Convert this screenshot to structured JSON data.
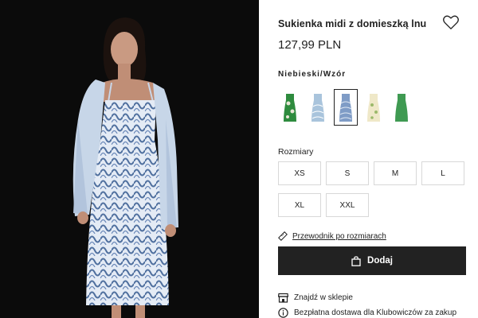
{
  "product": {
    "title": "Sukienka midi z domieszką lnu",
    "price": "127,99 PLN",
    "color_label": "Niebieski/Wzór"
  },
  "swatches": [
    {
      "name": "green-floral",
      "color": "#2e8b3e",
      "accent": "#e8e6d6",
      "selected": false
    },
    {
      "name": "light-blue-print",
      "color": "#a9c4dc",
      "accent": "#ffffff",
      "selected": false
    },
    {
      "name": "blue-pattern",
      "color": "#7f9cc6",
      "accent": "#dfe8f4",
      "selected": true
    },
    {
      "name": "cream-floral",
      "color": "#efe8c8",
      "accent": "#9bb96a",
      "selected": false
    },
    {
      "name": "green-solid",
      "color": "#3f9a52",
      "accent": "#3f9a52",
      "selected": false
    }
  ],
  "sizes": {
    "label": "Rozmiary",
    "options": [
      "XS",
      "S",
      "M",
      "L",
      "XL",
      "XXL"
    ]
  },
  "size_guide": {
    "label": "Przewodnik po rozmiarach",
    "icon": "ruler-icon"
  },
  "add_to_cart": {
    "label": "Dodaj",
    "icon": "bag-icon"
  },
  "store": {
    "label": "Znajdź w sklepie",
    "icon": "store-icon"
  },
  "delivery": {
    "label": "Bezpłatna dostawa dla Klubowiczów za zakup",
    "icon": "info-icon"
  },
  "colors": {
    "button_dark": "#222222",
    "border": "#d8d8d8",
    "photo_background": "#0b0b0b"
  }
}
